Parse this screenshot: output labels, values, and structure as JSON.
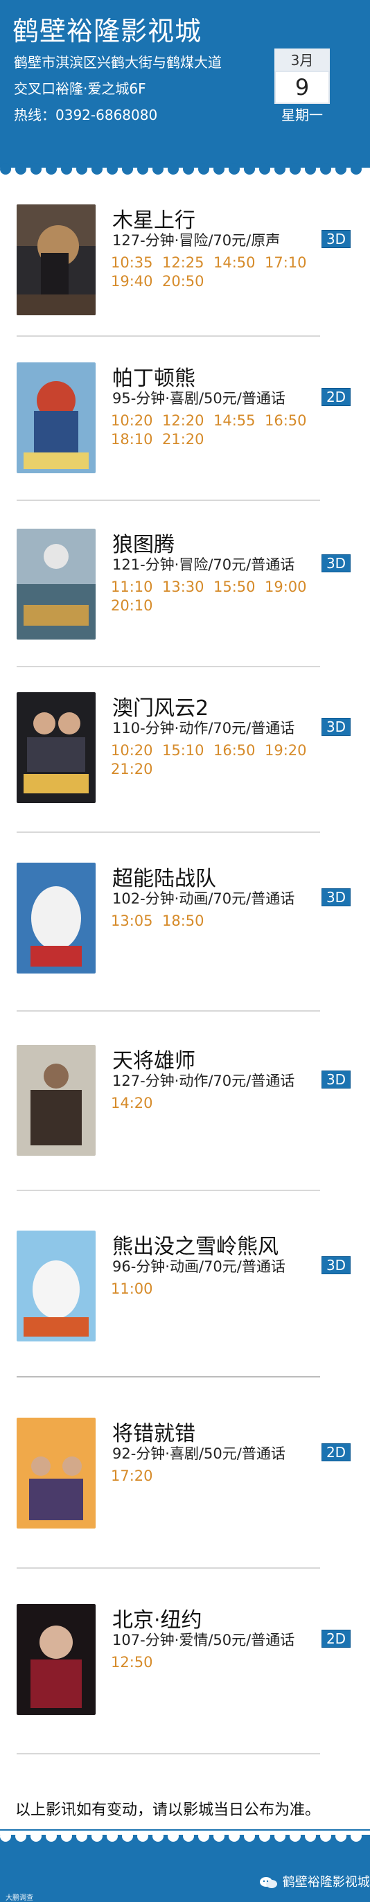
{
  "header": {
    "cinema_name": "鹤壁裕隆影视城",
    "address_line1": "鹤壁市淇滨区兴鹤大街与鹤煤大道",
    "address_line2": "交叉口裕隆·爱之城6F",
    "phone": "热线：0392-6868080",
    "date": {
      "month": "3月",
      "day": "9",
      "weekday": "星期一"
    }
  },
  "movies": [
    {
      "title": "木星上行",
      "info": "127-分钟·冒险/70元/原声",
      "format": "3D",
      "times": [
        "10:35",
        "12:25",
        "14:50",
        "17:10",
        "19:40",
        "20:50"
      ]
    },
    {
      "title": "帕丁顿熊",
      "info": "95-分钟·喜剧/50元/普通话",
      "format": "2D",
      "times": [
        "10:20",
        "12:20",
        "14:55",
        "16:50",
        "18:10",
        "21:20"
      ]
    },
    {
      "title": "狼图腾",
      "info": "121-分钟·冒险/70元/普通话",
      "format": "3D",
      "times": [
        "11:10",
        "13:30",
        "15:50",
        "19:00",
        "20:10"
      ]
    },
    {
      "title": "澳门风云2",
      "info": "110-分钟·动作/70元/普通话",
      "format": "3D",
      "times": [
        "10:20",
        "15:10",
        "16:50",
        "19:20",
        "21:20"
      ]
    },
    {
      "title": "超能陆战队",
      "info": "102-分钟·动画/70元/普通话",
      "format": "3D",
      "times": [
        "13:05",
        "18:50"
      ]
    },
    {
      "title": "天将雄师",
      "info": "127-分钟·动作/70元/普通话",
      "format": "3D",
      "times": [
        "14:20"
      ]
    },
    {
      "title": "熊出没之雪岭熊风",
      "info": "96-分钟·动画/70元/普通话",
      "format": "3D",
      "times": [
        "11:00"
      ]
    },
    {
      "title": "将错就错",
      "info": "92-分钟·喜剧/50元/普通话",
      "format": "2D",
      "times": [
        "17:20"
      ]
    },
    {
      "title": "北京·纽约",
      "info": "107-分钟·爱情/50元/普通话",
      "format": "2D",
      "times": [
        "12:50"
      ]
    }
  ],
  "notice": "以上影讯如有变动，请以影城当日公布为准。",
  "footer": {
    "wechat_account": "鹤壁裕隆影视城",
    "watermark": "大鹏调查"
  },
  "colors": {
    "brand": "#1b73b1",
    "time": "#d68b2a"
  }
}
